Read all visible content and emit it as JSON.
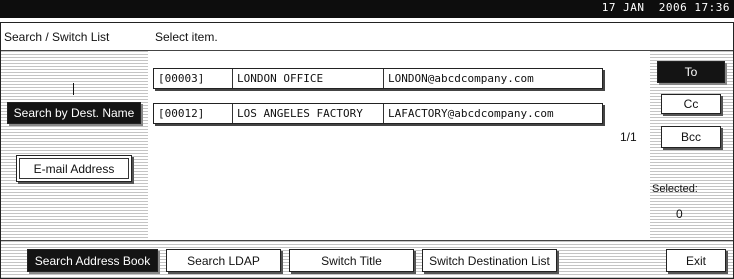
{
  "status_bar": {
    "datetime": "17 JAN  2006 17:36"
  },
  "header": {
    "title": "Search / Switch List",
    "instruction": "Select item."
  },
  "left_panel": {
    "search_by_dest_name": "Search by Dest. Name",
    "email_address": "E-mail Address"
  },
  "results": [
    {
      "number": "[00003]",
      "name": "LONDON OFFICE",
      "email": "LONDON@abcdcompany.com"
    },
    {
      "number": "[00012]",
      "name": "LOS ANGELES FACTORY",
      "email": "LAFACTORY@abcdcompany.com"
    }
  ],
  "pager": "1/1",
  "right_panel": {
    "to": "To",
    "cc": "Cc",
    "bcc": "Bcc",
    "selected_label": "Selected:",
    "selected_count": "0"
  },
  "bottom_bar": {
    "search_address_book": "Search Address Book",
    "search_ldap": "Search LDAP",
    "switch_title": "Switch Title",
    "switch_destination_list": "Switch Destination List",
    "exit": "Exit"
  }
}
